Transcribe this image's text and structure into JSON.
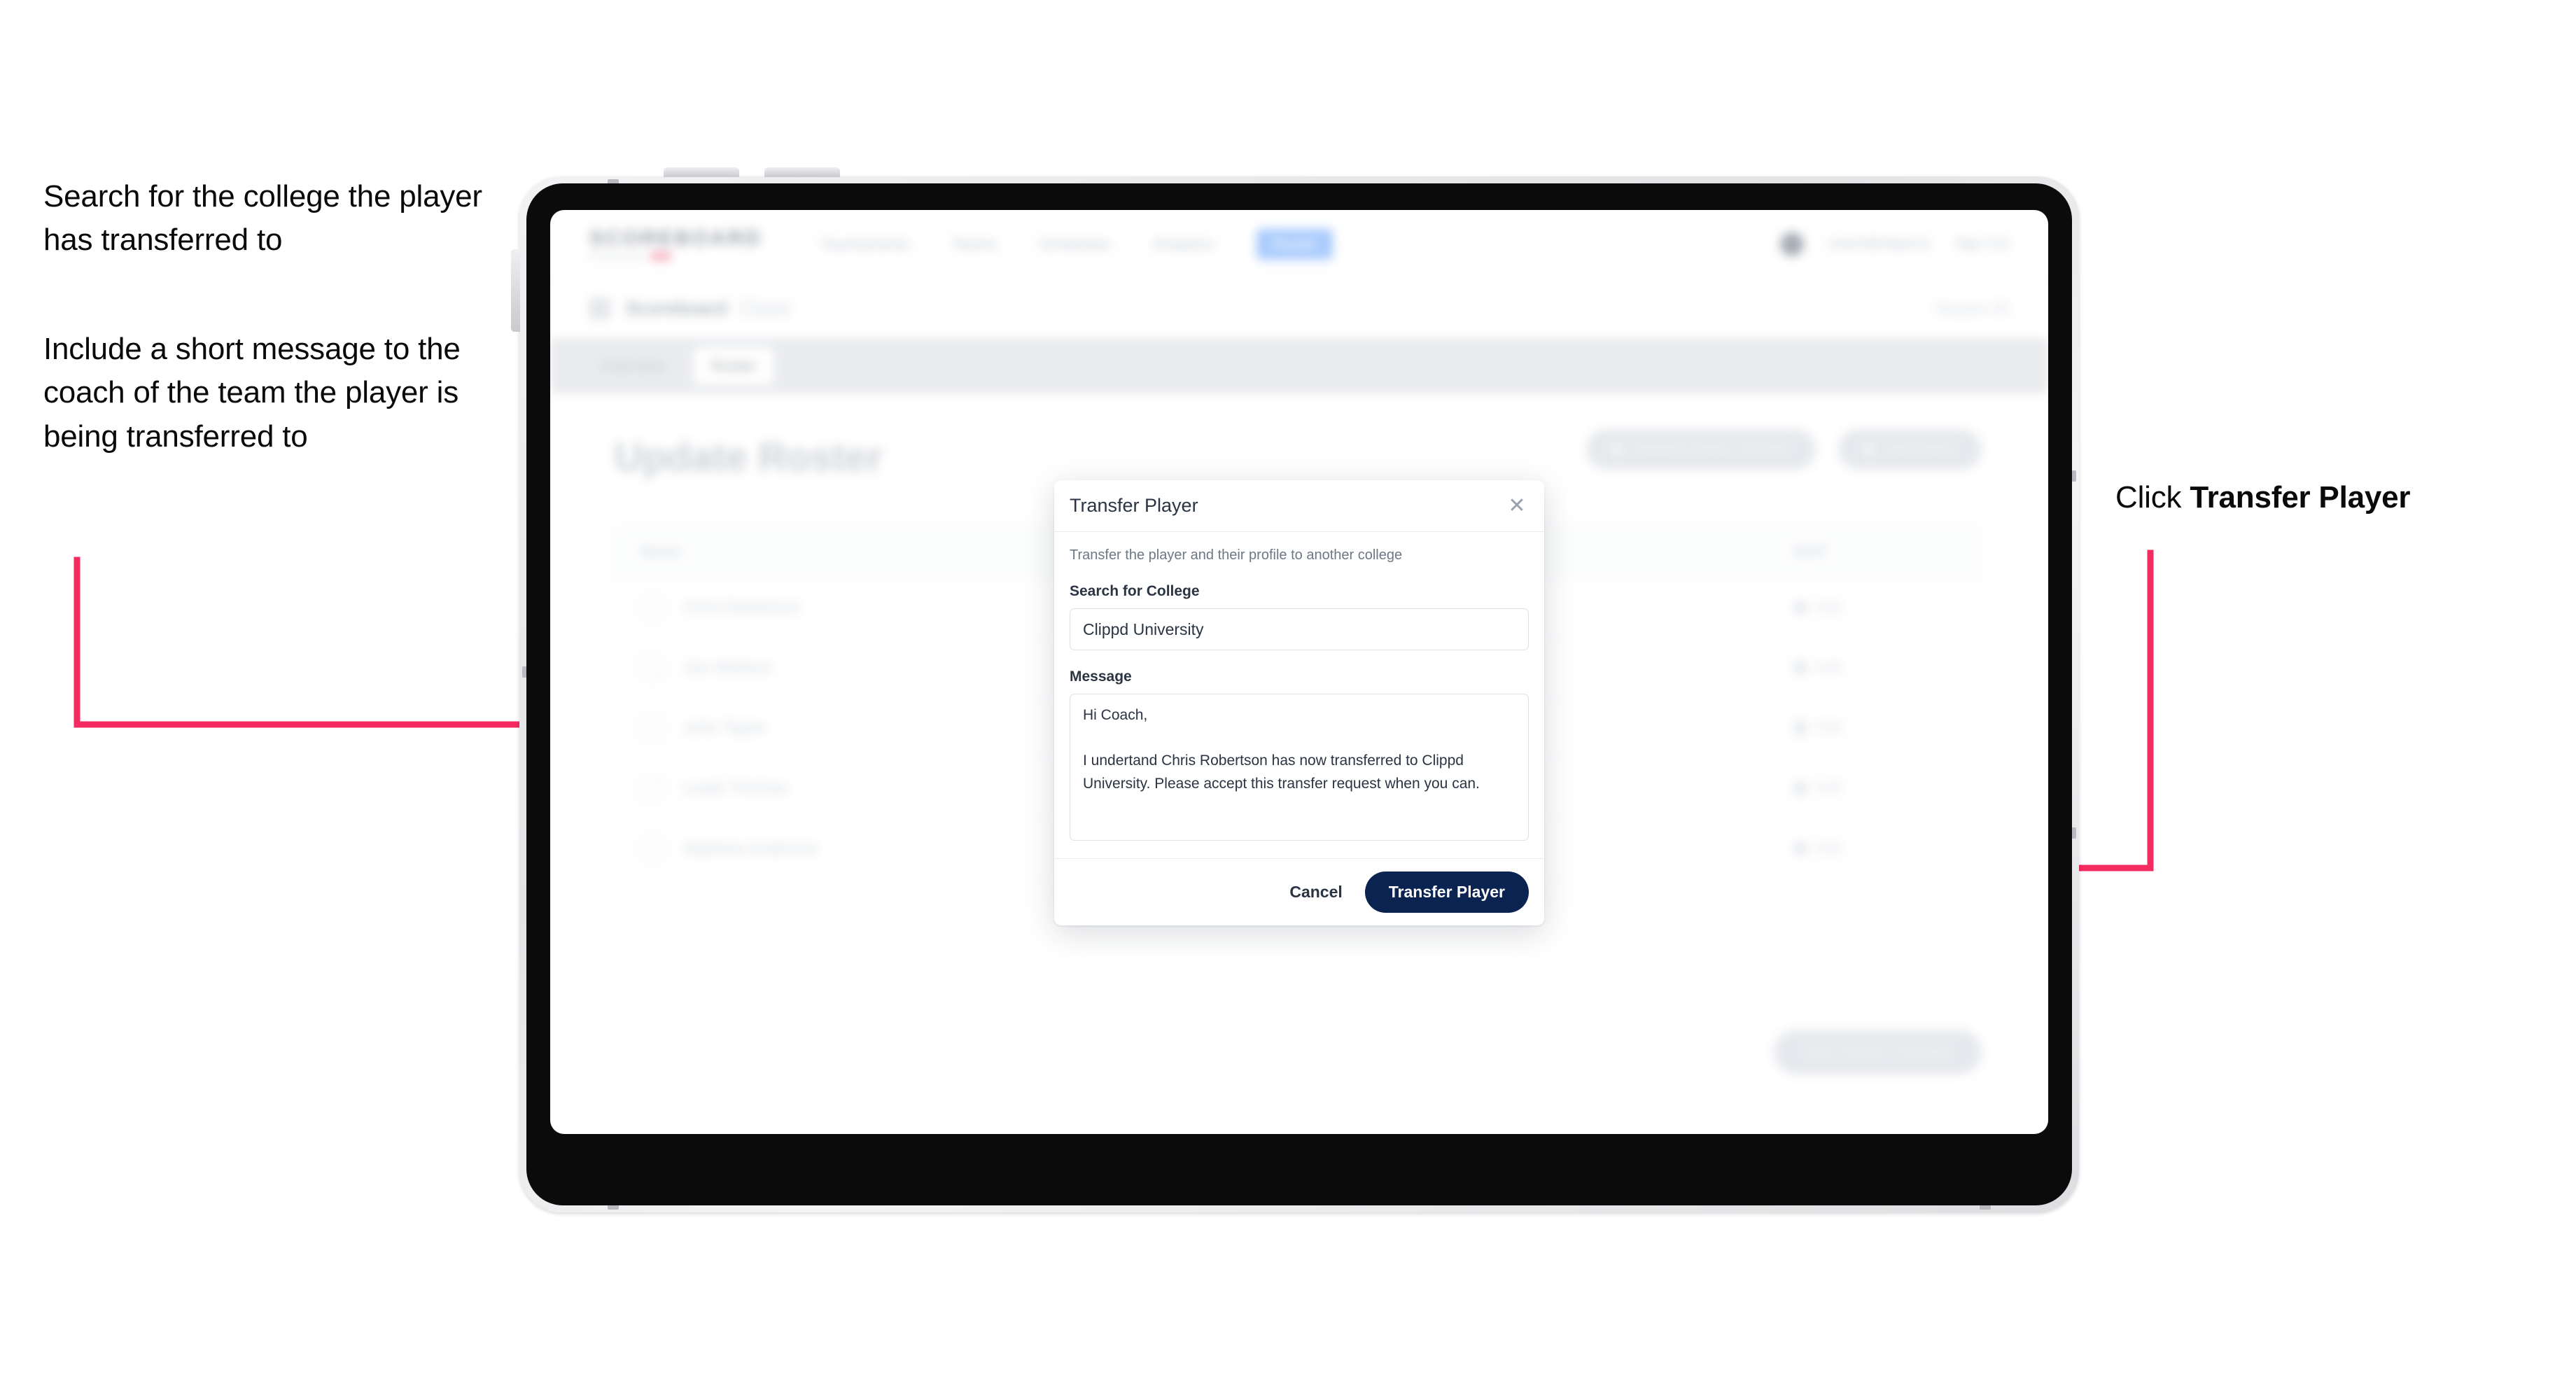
{
  "annotations": {
    "left_1": "Search for the college the player has transferred to",
    "left_2": "Include a short message to the coach of the team the player is being transferred to",
    "right_prefix": "Click ",
    "right_bold": "Transfer Player",
    "arrow_color": "#F32B61"
  },
  "app": {
    "nav": {
      "brand_name": "SCOREBOARD",
      "brand_sub": "Powered by",
      "links": [
        "Tournaments",
        "Teams",
        "Schedules",
        "Analytics"
      ],
      "active_link": "Roster",
      "account_email": "coach@clippd.io",
      "sign_out": "Sign Out"
    },
    "breadcrumb": {
      "main": "Scoreboard",
      "sub": "Clippd",
      "right": "Season 25"
    },
    "tabs": [
      {
        "label": "Overview",
        "active": false
      },
      {
        "label": "Roster",
        "active": true
      }
    ],
    "page_title": "Update Roster",
    "header_buttons": [
      "Request Player Transfer",
      "Add Player"
    ],
    "table": {
      "col_name": "Name",
      "col_action": "EDIT",
      "rows": [
        {
          "name": "Chris Robertson",
          "action": "Edit"
        },
        {
          "name": "Joe Wallace",
          "action": "Edit"
        },
        {
          "name": "John Taylor",
          "action": "Edit"
        },
        {
          "name": "Lewis Thomas",
          "action": "Edit"
        },
        {
          "name": "Matthew Anderson",
          "action": "Edit"
        }
      ]
    },
    "save_button": "Save Roster Changes"
  },
  "modal": {
    "title": "Transfer Player",
    "close_glyph": "✕",
    "description": "Transfer the player and their profile to another college",
    "college_label": "Search for College",
    "college_value": "Clippd University",
    "college_placeholder": "Search for College",
    "message_label": "Message",
    "message_value": "Hi Coach,\n\nI undertand Chris Robertson has now transferred to Clippd University. Please accept this transfer request when you can.",
    "message_placeholder": "Message",
    "cancel_label": "Cancel",
    "submit_label": "Transfer Player",
    "submit_color": "#0A2350"
  }
}
